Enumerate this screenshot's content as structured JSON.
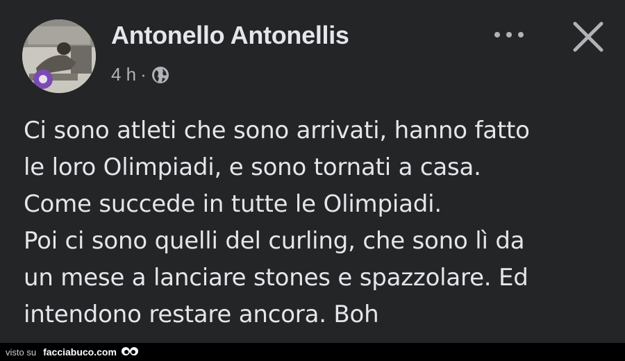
{
  "post": {
    "author": "Antonello Antonellis",
    "timestamp": "4 h",
    "separator": "·",
    "audience_icon": "globe-icon",
    "more_icon": "more-options-icon",
    "close_icon": "close-icon",
    "lines": [
      "Ci sono atleti che sono arrivati, hanno fatto",
      "le loro Olimpiadi, e sono tornati a casa.",
      "Come succede in tutte le Olimpiadi.",
      "Poi ci sono quelli del curling, che sono lì da",
      "un mese a lanciare stones e spazzolare. Ed",
      "intendono restare ancora. Boh"
    ]
  },
  "footer": {
    "visto_label": "visto su",
    "site_label": "facciabuco.com"
  },
  "colors": {
    "background": "#242526",
    "text_primary": "#e4e6eb",
    "text_secondary": "#b0b3b8",
    "footer_bg": "#000000"
  }
}
